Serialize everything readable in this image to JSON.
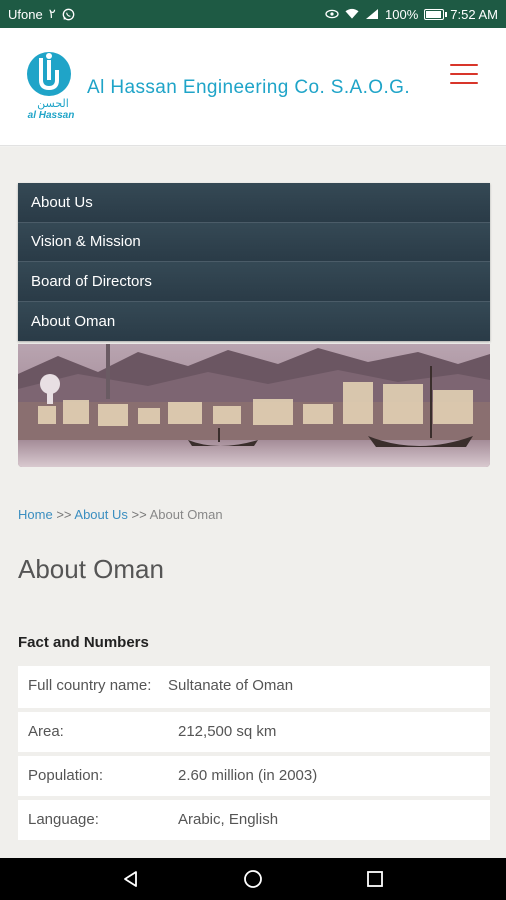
{
  "status_bar": {
    "carrier": "Ufone",
    "carrier_suffix": "۲",
    "battery": "100%",
    "time": "7:52 AM",
    "battery_level": 1.0
  },
  "header": {
    "company_name": "Al Hassan Engineering Co. S.A.O.G.",
    "logo_text_arabic": "الحسن",
    "logo_text": "al Hassan",
    "brand_color": "#1fa4c8",
    "menu_color": "#d8352a"
  },
  "submenu": {
    "items": [
      {
        "label": "About Us"
      },
      {
        "label": "Vision & Mission"
      },
      {
        "label": "Board of Directors"
      },
      {
        "label": "About Oman"
      }
    ]
  },
  "breadcrumb": {
    "home": "Home",
    "sep1": ">>",
    "about_us": "About Us",
    "sep2": ">>",
    "current": "About Oman"
  },
  "page": {
    "title": "About Oman",
    "section_title": "Fact and Numbers"
  },
  "facts": [
    {
      "key": "Full country name:",
      "value": "Sultanate of Oman"
    },
    {
      "key": "Area:",
      "value": "212,500 sq km"
    },
    {
      "key": "Population:",
      "value": "2.60 million (in 2003)"
    },
    {
      "key": "Language:",
      "value": "Arabic, English"
    }
  ],
  "colors": {
    "status_bar": "#1e5a44",
    "submenu_bg": "#2c3e4a",
    "link": "#3a8ec0"
  }
}
